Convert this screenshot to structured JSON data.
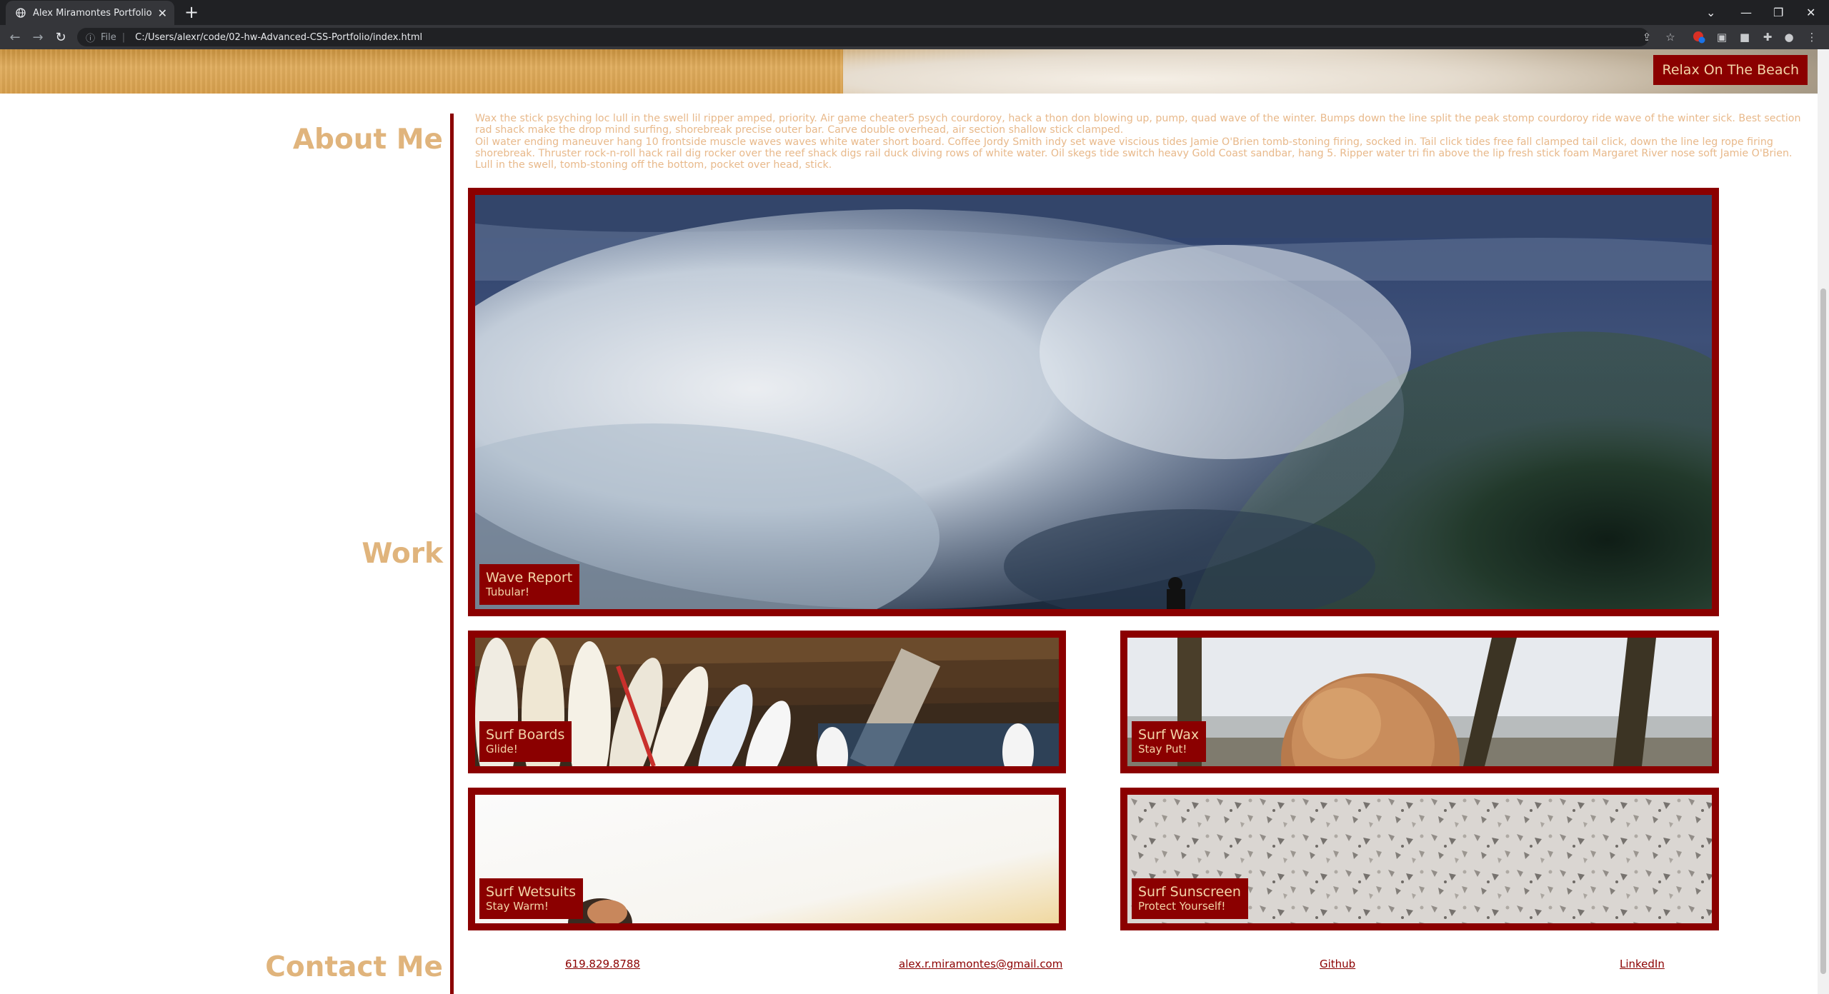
{
  "browser": {
    "tab_title": "Alex Miramontes Portfolio",
    "new_tab": "+",
    "scheme_label": "File",
    "url": "C:/Users/alexr/code/02-hw-Advanced-CSS-Portfolio/index.html",
    "toolbar_icons": [
      "share-icon",
      "star-icon",
      "extension-badge-icon",
      "extension-icon",
      "extension-gray-icon",
      "puzzle-icon",
      "profile-icon",
      "kebab-menu-icon"
    ]
  },
  "hero": {
    "button_label": "Relax On The Beach"
  },
  "about": {
    "title": "About Me",
    "paragraphs": [
      "Wax the stick psyching loc lull in the swell lil ripper amped, priority. Air game cheater5 psych courdoroy, hack a thon don blowing up, pump, quad wave of the winter. Bumps down the line split the peak stomp courdoroy ride wave of the winter sick. Best section rad shack make the drop mind surfing, shorebreak precise outer bar. Carve double overhead, air section shallow stick clamped.",
      "Oil water ending maneuver hang 10 frontside muscle waves waves white water short board. Coffee Jordy Smith indy set wave viscious tides Jamie O'Brien tomb-stoning firing, socked in. Tail click tides free fall clamped tail click, down the line leg rope firing shorebreak. Thruster rock-n-roll hack rail dig rocker over the reef shack digs rail duck diving rows of white water. Oil skegs tide switch heavy Gold Coast sandbar, hang 5. Ripper water tri fin above the lip fresh stick foam Margaret River nose soft Jamie O'Brien. Lull in the swell, tomb-stoning off the bottom, pocket over head, stick."
    ]
  },
  "work": {
    "title": "Work",
    "cards": [
      {
        "title": "Wave Report",
        "subtitle": "Tubular!"
      },
      {
        "title": "Surf Boards",
        "subtitle": "Glide!"
      },
      {
        "title": "Surf Wax",
        "subtitle": "Stay Put!"
      },
      {
        "title": "Surf Wetsuits",
        "subtitle": "Stay Warm!"
      },
      {
        "title": "Surf Sunscreen",
        "subtitle": "Protect Yourself!"
      }
    ]
  },
  "contact": {
    "title": "Contact Me",
    "links": [
      "619.829.8788",
      "alex.r.miramontes@gmail.com",
      "Github",
      "LinkedIn"
    ]
  },
  "colors": {
    "accent": "#8b0000",
    "heading": "#e0b47c",
    "body_text": "#e8b98b",
    "label_text": "#f3d5a8"
  }
}
